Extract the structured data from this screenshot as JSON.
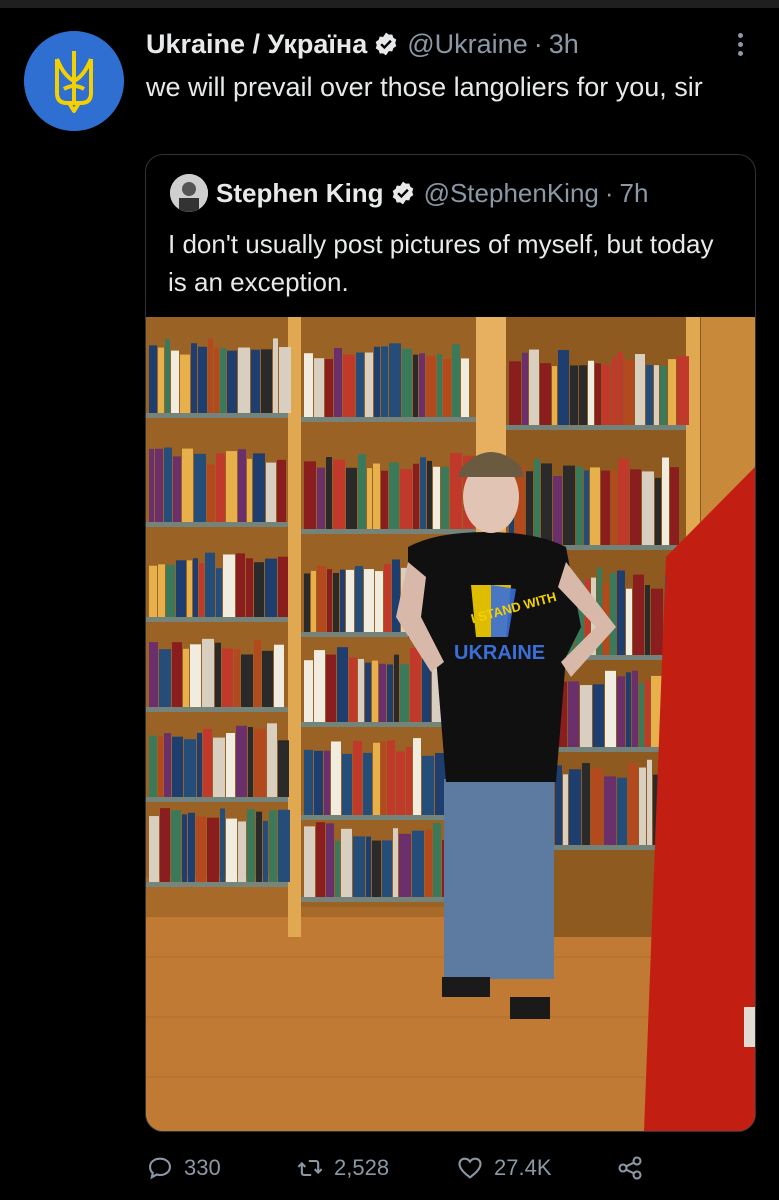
{
  "tweet": {
    "display_name": "Ukraine / Україна",
    "handle": "@Ukraine",
    "time": "3h",
    "separator": "·",
    "text": "we will prevail over those langoliers for you, sir"
  },
  "quoted": {
    "display_name": "Stephen King",
    "handle": "@StephenKing",
    "time": "7h",
    "separator": "·",
    "text": "I don't usually post pictures of myself, but today is an exception.",
    "photo": {
      "shirt_text_top": "I STAND WITH",
      "shirt_text_bottom": "UKRAINE"
    }
  },
  "actions": {
    "replies": "330",
    "retweets": "2,528",
    "likes": "27.4K"
  },
  "icons": {
    "verified": "verified-badge-icon",
    "more": "more-options-icon",
    "reply": "reply-icon",
    "retweet": "retweet-icon",
    "like": "heart-icon",
    "share": "share-icon"
  },
  "colors": {
    "background": "#000000",
    "text": "#e7e9ea",
    "muted": "#8b98a5",
    "ukraine_blue": "#2f6fd1",
    "ukraine_yellow": "#f5d000"
  }
}
